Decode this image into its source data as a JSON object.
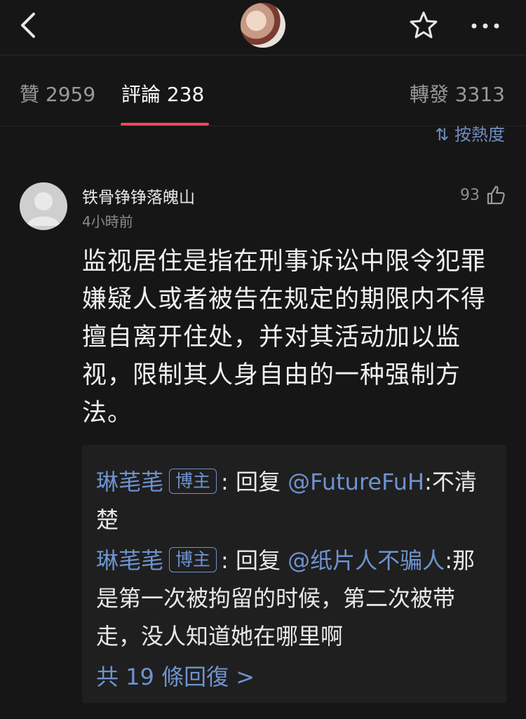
{
  "header": {
    "back_icon": "chevron-left-icon",
    "favorite_icon": "star-icon",
    "more_icon": "more-horizontal-icon"
  },
  "tabs": [
    {
      "label": "贊 2959"
    },
    {
      "label": "評論 238"
    },
    {
      "label": "轉發 3313"
    }
  ],
  "sort": {
    "label": "按熱度"
  },
  "comment": {
    "author": "铁骨铮铮落魄山",
    "time": "4小時前",
    "likes": "93",
    "text": "监视居住是指在刑事诉讼中限令犯罪嫌疑人或者被告在规定的期限内不得擅自离开住处，并对其活动加以监视，限制其人身自由的一种强制方法。",
    "replies": [
      {
        "author": "琳芼芼",
        "badge": "博主",
        "sep": ": 回复 ",
        "mention": "@FutureFuH",
        "text": ":不清楚"
      },
      {
        "author": "琳芼芼",
        "badge": "博主",
        "sep": ": 回复 ",
        "mention": "@纸片人不骗人",
        "text": ":那是第一次被拘留的时候，第二次被带走，没人知道她在哪里啊"
      }
    ],
    "more_replies": "共 19 條回復 >"
  }
}
